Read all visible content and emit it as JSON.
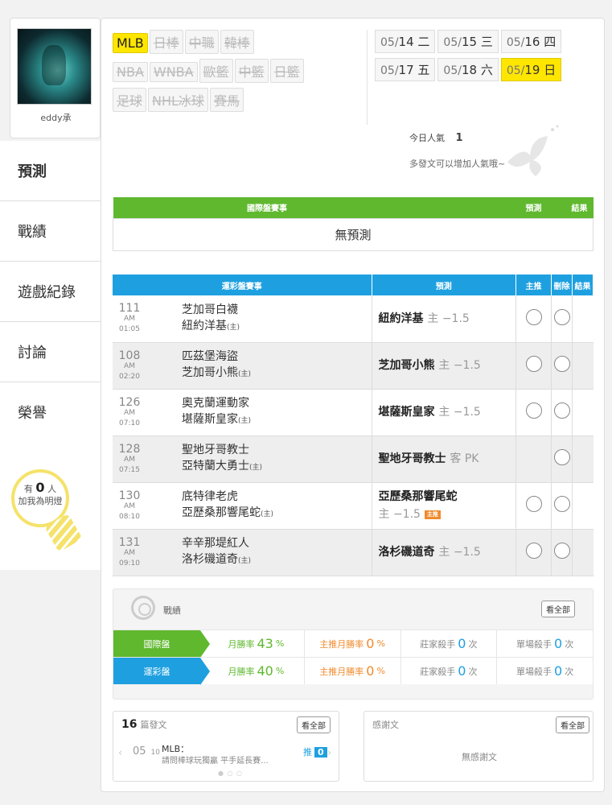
{
  "user": {
    "name": "eddy承"
  },
  "nav": [
    "預測",
    "戰績",
    "遊戲紀錄",
    "討論",
    "榮譽"
  ],
  "fans": {
    "prefix": "有",
    "count": "0",
    "unit": "人",
    "caption": "加我為明燈"
  },
  "sports": [
    {
      "label": "MLB",
      "active": true
    },
    {
      "label": "日棒"
    },
    {
      "label": "中職"
    },
    {
      "label": "韓棒"
    },
    {
      "label": "NBA"
    },
    {
      "label": "WNBA"
    },
    {
      "label": "歐籃"
    },
    {
      "label": "中籃"
    },
    {
      "label": "日籃"
    },
    {
      "label": "足球"
    },
    {
      "label": "NHL冰球"
    },
    {
      "label": "賽馬"
    }
  ],
  "dates": [
    {
      "md": "05/",
      "d": "14",
      "wd": "二"
    },
    {
      "md": "05/",
      "d": "15",
      "wd": "三"
    },
    {
      "md": "05/",
      "d": "16",
      "wd": "四"
    },
    {
      "md": "05/",
      "d": "17",
      "wd": "五"
    },
    {
      "md": "05/",
      "d": "18",
      "wd": "六"
    },
    {
      "md": "05/",
      "d": "19",
      "wd": "日",
      "active": true
    }
  ],
  "popularity": {
    "label": "今日人氣",
    "value": "1",
    "hint": "多發文可以增加人氣哦~"
  },
  "intl_table": {
    "headers": [
      "國際盤賽事",
      "預測",
      "結果"
    ],
    "empty": "無預測"
  },
  "lottery_table": {
    "headers": [
      "運彩盤賽事",
      "預測",
      "主推",
      "刪除",
      "結果"
    ],
    "rows": [
      {
        "no": "111",
        "time": "AM 01:05",
        "away": "芝加哥白襪",
        "home": "紐約洋基",
        "tag": "(主)",
        "pick": "紐約洋基",
        "spread": "主 −1.5",
        "main": true,
        "del": true
      },
      {
        "no": "108",
        "time": "AM 02:20",
        "away": "匹茲堡海盜",
        "home": "芝加哥小熊",
        "tag": "(主)",
        "pick": "芝加哥小熊",
        "spread": "主 −1.5",
        "main": true,
        "del": true
      },
      {
        "no": "126",
        "time": "AM 07:10",
        "away": "奧克蘭運動家",
        "home": "堪薩斯皇家",
        "tag": "(主)",
        "pick": "堪薩斯皇家",
        "spread": "主 −1.5",
        "main": true,
        "del": true
      },
      {
        "no": "128",
        "time": "AM 07:15",
        "away": "聖地牙哥教士",
        "home": "亞特蘭大勇士",
        "tag": "(主)",
        "pick": "聖地牙哥教士",
        "spread": "客 PK",
        "main": false,
        "del": true
      },
      {
        "no": "130",
        "time": "AM 08:10",
        "away": "底特律老虎",
        "home": "亞歷桑那響尾蛇",
        "tag": "(主)",
        "pick": "亞歷桑那響尾蛇",
        "spread": "主 −1.5",
        "badge": "主推",
        "main": true,
        "del": true
      },
      {
        "no": "131",
        "time": "AM 09:10",
        "away": "辛辛那堤紅人",
        "home": "洛杉磯道奇",
        "tag": "(主)",
        "pick": "洛杉磯道奇",
        "spread": "主 −1.5",
        "main": true,
        "del": true
      }
    ]
  },
  "record": {
    "title": "戰績",
    "view_all": "看全部",
    "rows": [
      {
        "label": "國際盤",
        "color": "#5fb82e",
        "win_label": "月勝率",
        "win": "43",
        "main_label": "主推月勝率",
        "main": "0",
        "house_label": "莊家殺手",
        "house": "0",
        "single_label": "單場殺手",
        "single": "0",
        "unit_pct": "%",
        "unit_times": "次"
      },
      {
        "label": "運彩盤",
        "color": "#1ea0e0",
        "win_label": "月勝率",
        "win": "40",
        "main_label": "主推月勝率",
        "main": "0",
        "house_label": "莊家殺手",
        "house": "0",
        "single_label": "單場殺手",
        "single": "0",
        "unit_pct": "%",
        "unit_times": "次"
      }
    ]
  },
  "posts": {
    "count": "16",
    "unit": "篇發文",
    "view_all": "看全部",
    "month": "05",
    "day": "10",
    "category": "MLB：",
    "text": "請問棒球玩獨贏 平手延長賽...",
    "push_label": "推",
    "push": "0"
  },
  "thanks": {
    "title": "感謝文",
    "view_all": "看全部",
    "empty": "無感謝文"
  }
}
